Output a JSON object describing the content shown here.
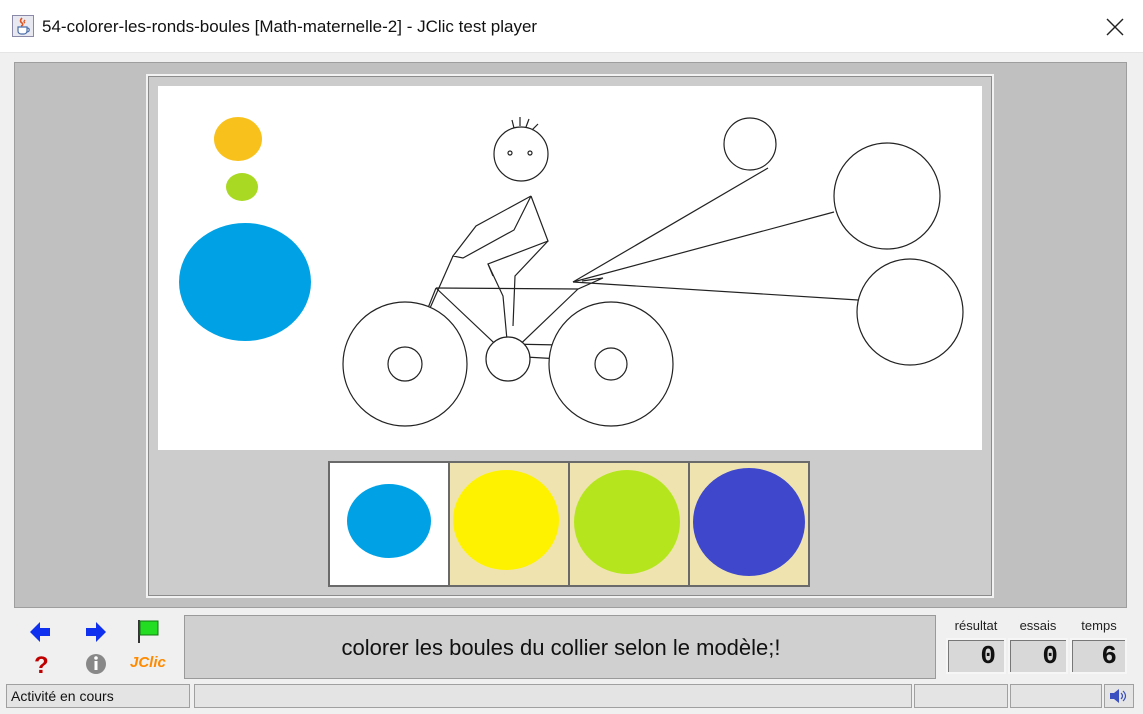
{
  "window": {
    "title": "54-colorer-les-ronds-boules [Math-maternelle-2] - JClic test player",
    "app_icon": "java-cup-icon",
    "close_icon": "close-icon"
  },
  "activity": {
    "model_colors": [
      "#f9c11b",
      "#a9d923",
      "#00a2e5"
    ],
    "palette": [
      {
        "color": "#00a2e5",
        "background": "#ffffff",
        "selected": true
      },
      {
        "color": "#fff200",
        "background": "#efe4b0",
        "selected": false
      },
      {
        "color": "#b5e61d",
        "background": "#efe4b0",
        "selected": false
      },
      {
        "color": "#3f48cc",
        "background": "#efe4b0",
        "selected": false
      }
    ]
  },
  "controls": {
    "prev_icon": "arrow-left-icon",
    "next_icon": "arrow-right-icon",
    "flag_icon": "green-flag-icon",
    "help_icon": "question-mark-icon",
    "info_icon": "info-icon",
    "jclic_logo": "JClic"
  },
  "message": "colorer les boules du collier selon le modèle;!",
  "counters": {
    "result_label": "résultat",
    "result_value": "0",
    "tries_label": "essais",
    "tries_value": "0",
    "time_label": "temps",
    "time_value": "6"
  },
  "status": {
    "text": "Activité en cours",
    "sound_icon": "speaker-icon"
  }
}
